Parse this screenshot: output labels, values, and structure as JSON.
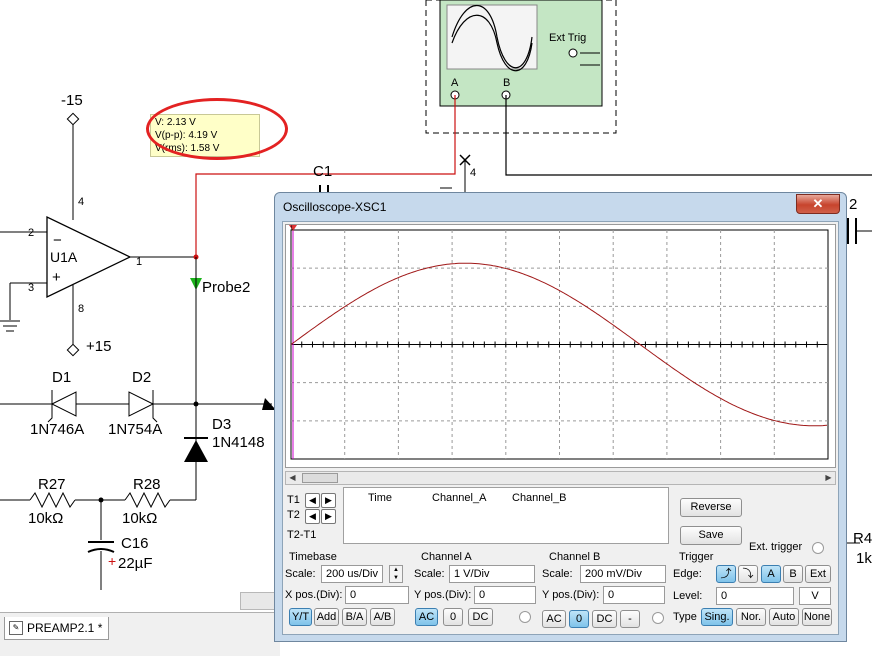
{
  "schematic": {
    "labels": {
      "neg15": "-15",
      "pos15": "+15",
      "opamp": "U1A",
      "pin2": "2",
      "pin3": "3",
      "pin4": "4",
      "pin8": "8",
      "pin1": "1",
      "probe": "Probe2",
      "c1": "C1",
      "net4": "4",
      "d1": "D1",
      "d1_part": "1N746A",
      "d2": "D2",
      "d2_part": "1N754A",
      "d3": "D3",
      "d3_part": "1N4148",
      "r27": "R27",
      "r27_val": "10kΩ",
      "r28": "R28",
      "r28_val": "10kΩ",
      "c16": "C16",
      "c16_val": "22µF",
      "r4": "R4",
      "r4_val": "1k",
      "cap2": "2",
      "ext_trig": "Ext Trig",
      "scope_a": "A",
      "scope_b": "B",
      "plus": "+",
      "minus": "−"
    },
    "probe_readout": {
      "v": "V: 2.13 V",
      "vpp": "V(p-p): 4.19 V",
      "vrms": "V(rms): 1.58 V"
    },
    "colors": {
      "wire_probe": "#cc1111",
      "probe_highlight": "#e32222",
      "scope_body": "#c4e6c4"
    }
  },
  "tabbar": {
    "tab_label": "PREAMP2.1 *"
  },
  "oscilloscope": {
    "title": "Oscilloscope-XSC1",
    "close_label": "✕",
    "cursor_labels": {
      "t1": "T1",
      "t2": "T2",
      "t2t1": "T2-T1"
    },
    "readout_headers": {
      "time": "Time",
      "channel_a": "Channel_A",
      "channel_b": "Channel_B"
    },
    "buttons": {
      "reverse": "Reverse",
      "save": "Save"
    },
    "ext_trigger_label": "Ext. trigger",
    "timebase": {
      "title": "Timebase",
      "scale_label": "Scale:",
      "scale_value": "200 us/Div",
      "xpos_label": "X pos.(Div):",
      "xpos_value": "0",
      "modes": [
        "Y/T",
        "Add",
        "B/A",
        "A/B"
      ]
    },
    "channel_a": {
      "title": "Channel A",
      "scale_label": "Scale:",
      "scale_value": "1  V/Div",
      "ypos_label": "Y pos.(Div):",
      "ypos_value": "0",
      "coupling": [
        "AC",
        "0",
        "DC"
      ]
    },
    "channel_b": {
      "title": "Channel B",
      "scale_label": "Scale:",
      "scale_value": "200 mV/Div",
      "ypos_label": "Y pos.(Div):",
      "ypos_value": "0",
      "coupling": [
        "AC",
        "0",
        "DC",
        "-"
      ]
    },
    "trigger": {
      "title": "Trigger",
      "edge_label": "Edge:",
      "edge_sources": [
        "A",
        "B",
        "Ext"
      ],
      "level_label": "Level:",
      "level_value": "0",
      "level_unit": "V",
      "type_label": "Type",
      "types": [
        "Sing.",
        "Nor.",
        "Auto",
        "None"
      ]
    },
    "trace_color": "#a01818",
    "trace": {
      "amplitude_v": 2.13,
      "period_us": 2600,
      "volts_per_div": 1,
      "us_per_div": 200,
      "start_us": 0
    }
  }
}
